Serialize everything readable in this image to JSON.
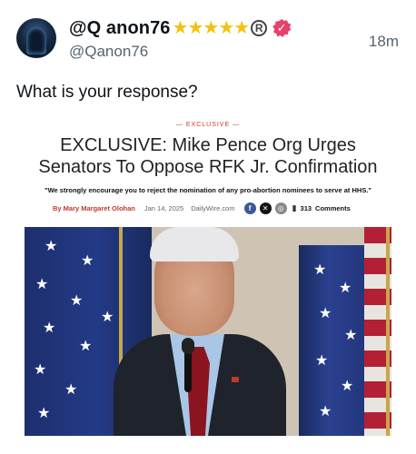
{
  "post": {
    "display_name": "@Q anon76",
    "stars": [
      "★",
      "★",
      "★",
      "★",
      "★"
    ],
    "registered_mark": "R",
    "verified_mark": "✓",
    "handle": "@Qanon76",
    "time": "18m",
    "text": "What is your response?"
  },
  "card": {
    "kicker": "— EXCLUSIVE —",
    "headline": "EXCLUSIVE: Mike Pence Org Urges Senators To Oppose RFK Jr. Confirmation",
    "quote": "\"We strongly encourage you to reject the nomination of any pro-abortion nominees to serve at HHS.\"",
    "author": "By Mary Margaret Olohan",
    "date": "Jan 14, 2025",
    "site": "DailyWire.com",
    "share_fb": "f",
    "share_x": "✕",
    "share_other": "◎",
    "comment_count": "313",
    "comment_label": "Comments"
  },
  "colors": {
    "star": "#f4c20d",
    "verified": "#e8416b",
    "kicker": "#d0392b",
    "author": "#c0392b"
  },
  "icons": [
    "avatar-image",
    "star-icon",
    "registered-icon",
    "verified-badge-icon",
    "facebook-icon",
    "x-icon",
    "share-icon",
    "comment-icon"
  ]
}
